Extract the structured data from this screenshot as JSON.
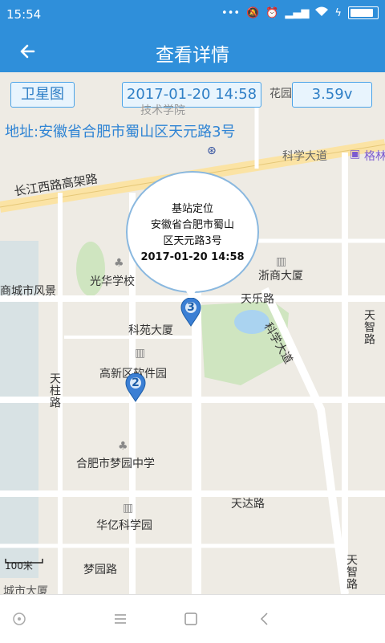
{
  "status_bar": {
    "time": "15:54",
    "icons": [
      "more-icon",
      "mute-icon",
      "alarm-icon",
      "signal-icon",
      "wifi-icon",
      "charging-icon",
      "battery-icon"
    ]
  },
  "app_bar": {
    "title": "查看详情",
    "back_icon": "back-arrow-icon"
  },
  "toolbar": {
    "satellite_label": "卫星图",
    "datetime": "2017-01-20 14:58",
    "voltage": "3.59v"
  },
  "address": "地址:安徽省合肥市蜀山区天元路3号",
  "popup": {
    "type": "基站定位",
    "address_line1": "安徽省合肥市蜀山",
    "address_line2": "区天元路3号",
    "time": "2017-01-20 14:58"
  },
  "markers": [
    {
      "number": "3"
    },
    {
      "number": "2"
    }
  ],
  "map_labels": {
    "hua_yuan": "花园",
    "tech_college": "技术学院",
    "keji_dadao_top": "科学大道",
    "hotel": "格林",
    "changjiang_rd": "长江西路高架路",
    "guanghua": "光华学校",
    "zheshang": "浙商大厦",
    "shangcheng": "商城市风景",
    "tianle": "天乐路",
    "keji_dadao_diag": "科学大道",
    "tianzhi_top": "天智路",
    "keyuan": "科苑大厦",
    "gaoxin": "高新区软件园",
    "tianzhu": "天柱路",
    "mengyuan_school": "合肥市梦园中学",
    "tianda": "天达路",
    "huayi": "华亿科学园",
    "mengyuan_rd": "梦园路",
    "tianzhi_bottom": "天智路",
    "partial_bottom": "城市大厦"
  },
  "scale": "100米",
  "nav": {
    "buttons": [
      "assist-dot-icon",
      "menu-icon",
      "home-square-icon",
      "back-chevron-icon"
    ]
  },
  "colors": {
    "primary": "#2f8fda",
    "chip_border": "#4aa3e8",
    "address_text": "#2f84d4",
    "map_bg": "#eeebe4"
  }
}
